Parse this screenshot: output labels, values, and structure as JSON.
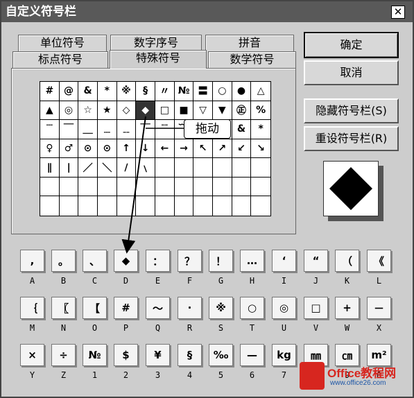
{
  "window": {
    "title": "自定义符号栏",
    "close_icon": "close-icon"
  },
  "tabs": {
    "row1": [
      "单位符号",
      "数字序号",
      "拼音"
    ],
    "row2": [
      "标点符号",
      "特殊符号",
      "数学符号"
    ],
    "active": "特殊符号"
  },
  "buttons": {
    "ok": "确定",
    "cancel": "取消",
    "hide": "隐藏符号栏(S)",
    "reset": "重设符号栏(R)"
  },
  "symbol_grid": [
    [
      "#",
      "@",
      "&",
      "*",
      "※",
      "§",
      "〃",
      "№",
      "〓",
      "○",
      "●",
      "△"
    ],
    [
      "▲",
      "◎",
      "☆",
      "★",
      "◇",
      "◆",
      "□",
      "■",
      "▽",
      "▼",
      "㊣",
      "%"
    ],
    [
      "﹉",
      "￣",
      "＿",
      "﹍",
      "﹎",
      "￣",
      "﹊",
      "﹋",
      "﹌",
      "﹏",
      "&",
      "*"
    ],
    [
      "♀",
      "♂",
      "⊙",
      "⊙",
      "↑",
      "↓",
      "←",
      "→",
      "↖",
      "↗",
      "↙",
      "↘"
    ],
    [
      "∥",
      "∣",
      "／",
      "＼",
      "∕",
      "﹨",
      "",
      "",
      "",
      "",
      "",
      ""
    ],
    [
      "",
      "",
      "",
      "",
      "",
      "",
      "",
      "",
      "",
      "",
      "",
      ""
    ],
    [
      "",
      "",
      "",
      "",
      "",
      "",
      "",
      "",
      "",
      "",
      "",
      ""
    ]
  ],
  "selected_symbol": "◆",
  "drag_label": "拖动",
  "preview_symbol": "◆",
  "key_rows": [
    {
      "symbols": [
        ",",
        "。",
        "、",
        "◆",
        "：",
        "？",
        "！",
        "…",
        "‘",
        "“",
        "（",
        "《"
      ],
      "labels": [
        "A",
        "B",
        "C",
        "D",
        "E",
        "F",
        "G",
        "H",
        "I",
        "J",
        "K",
        "L"
      ]
    },
    {
      "symbols": [
        "｛",
        "〖",
        "【",
        "#",
        "～",
        "·",
        "※",
        "○",
        "◎",
        "□",
        "+",
        "－"
      ],
      "labels": [
        "M",
        "N",
        "O",
        "P",
        "Q",
        "R",
        "S",
        "T",
        "U",
        "V",
        "W",
        "X"
      ]
    },
    {
      "symbols": [
        "×",
        "÷",
        "№",
        "$",
        "¥",
        "§",
        "‰",
        "—",
        "kg",
        "㎜",
        "㎝",
        "m²"
      ],
      "labels": [
        "Y",
        "Z",
        "1",
        "2",
        "3",
        "4",
        "5",
        "6",
        "7",
        "8",
        "9",
        "0"
      ]
    }
  ],
  "watermark": {
    "brand": "Office教程网",
    "url": "www.office26.com"
  }
}
